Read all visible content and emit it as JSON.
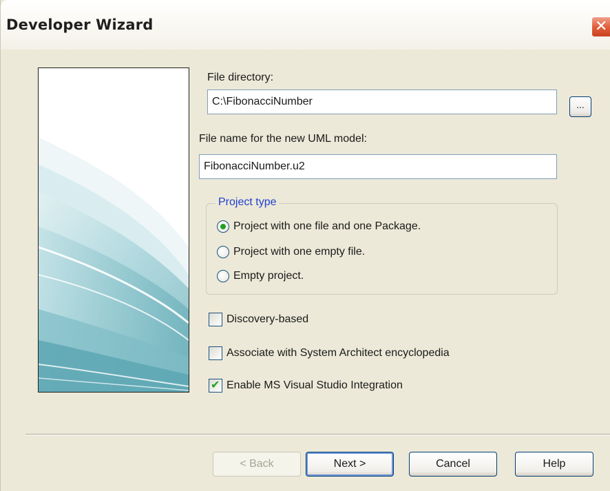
{
  "window": {
    "title": "Developer Wizard",
    "close_glyph": "✕"
  },
  "side_image": {
    "icon": "wizard-banner-waves"
  },
  "file_directory": {
    "label": "File directory:",
    "value": "C:\\FibonacciNumber",
    "browse_label": "..."
  },
  "file_name": {
    "label": "File name for the new UML model:",
    "value": "FibonacciNumber.u2"
  },
  "project_type": {
    "legend": "Project type",
    "options": [
      {
        "label": "Project with one file and one Package.",
        "selected": true
      },
      {
        "label": "Project with one empty file.",
        "selected": false
      },
      {
        "label": "Empty project.",
        "selected": false
      }
    ]
  },
  "options": {
    "discovery": {
      "label": "Discovery-based",
      "checked": false
    },
    "associate": {
      "label": "Associate with System Architect encyclopedia",
      "checked": false
    },
    "vs_integration": {
      "label": "Enable MS Visual Studio Integration",
      "checked": true
    }
  },
  "buttons": {
    "back": "< Back",
    "next": "Next >",
    "cancel": "Cancel",
    "help": "Help"
  },
  "colors": {
    "window_bg": "#ece9d8",
    "accent_blue": "#1f3fd0",
    "check_green": "#21a121",
    "close_red": "#e2603e"
  }
}
